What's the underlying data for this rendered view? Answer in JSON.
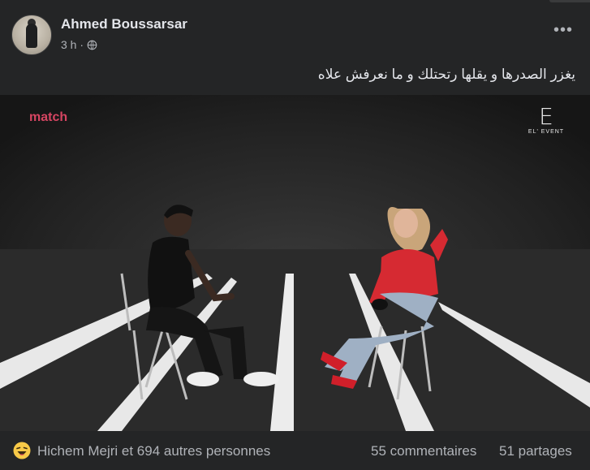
{
  "post": {
    "author": "Ahmed Boussarsar",
    "time": "3 h ·",
    "caption": "يغزر الصدرها و يقلها رتحتلك و ما نعرفش علاه",
    "more_label": "•••"
  },
  "video": {
    "channel_logo": "match",
    "event_logo_mark": "E",
    "event_logo_text": "EL' EVENT"
  },
  "footer": {
    "reactions": "Hichem Mejri et 694 autres personnes",
    "comments": "55 commentaires",
    "shares": "51 partages"
  },
  "icons": {
    "audience": "globe-icon",
    "reaction": "haha-emoji-icon",
    "menu": "more-options-icon"
  },
  "colors": {
    "background": "#242526",
    "text_primary": "#e4e6eb",
    "text_secondary": "#b0b3b8",
    "channel_logo": "#d64562",
    "stage_floor": "#2b2b2b"
  }
}
